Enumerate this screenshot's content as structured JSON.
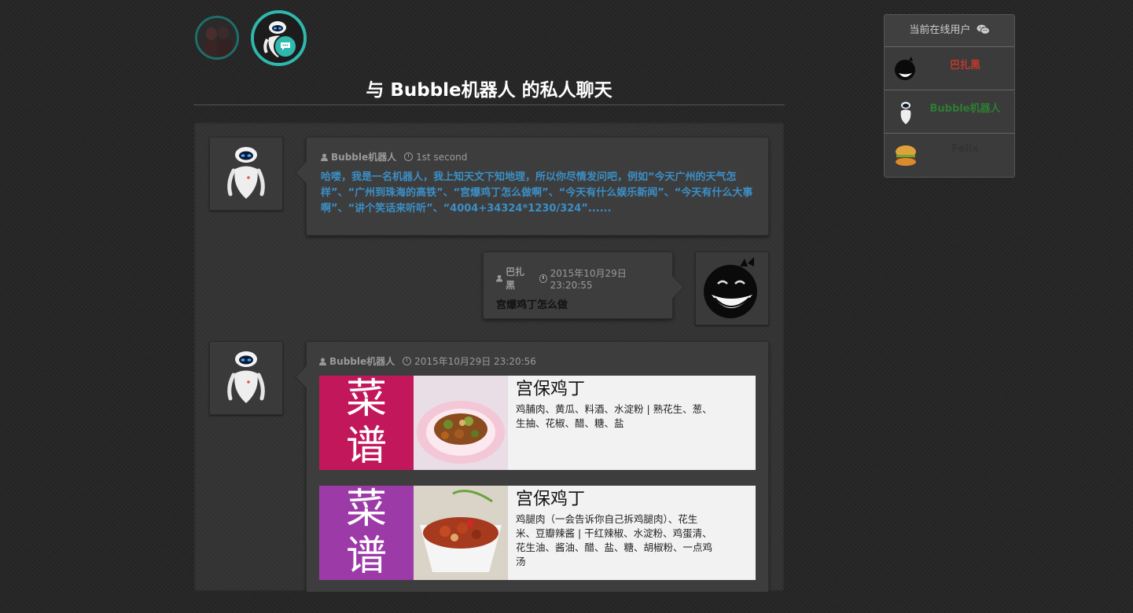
{
  "header": {
    "chat_title": "与 Bubble机器人 的私人聊天"
  },
  "online_users": {
    "title": "当前在线用户",
    "users": [
      {
        "name": "巴扎黑",
        "color": "#c0392b"
      },
      {
        "name": "Bubble机器人",
        "color": "#2e7d32"
      },
      {
        "name": "Felix",
        "color": "#333333"
      }
    ]
  },
  "messages": [
    {
      "sender": "Bubble机器人",
      "time": "1st second",
      "text": "哈喽，我是一名机器人，我上知天文下知地理，所以你尽情发问吧，例如“今天广州的天气怎样”、“广州到珠海的高铁”、“宫爆鸡丁怎么做啊”、“今天有什么娱乐新闻”、“今天有什么大事啊”、“讲个笑话来听听”、“4004+34324*1230/324”......",
      "text_color": "#3b8fc6"
    },
    {
      "sender": "巴扎黑",
      "time": "2015年10月29日 23:20:55",
      "text": "宫爆鸡丁怎么做",
      "text_color": "#111111"
    },
    {
      "sender": "Bubble机器人",
      "time": "2015年10月29日 23:20:56",
      "recipes": [
        {
          "tag_line1": "菜",
          "tag_line2": "谱",
          "tag_color": "#c2185b",
          "title": "宫保鸡丁",
          "desc": "鸡脯肉、黄瓜、料酒、水淀粉 | 熟花生、葱、生抽、花椒、醋、糖、盐"
        },
        {
          "tag_line1": "菜",
          "tag_line2": "谱",
          "tag_color": "#9c3aa8",
          "title": "宫保鸡丁",
          "desc": "鸡腿肉（一会告诉你自己拆鸡腿肉）、花生米、豆瓣辣酱 | 干红辣椒、水淀粉、鸡蛋清、花生油、酱油、醋、盐、糖、胡椒粉、一点鸡汤"
        }
      ]
    }
  ],
  "icons": {
    "user": "user-icon",
    "clock": "clock-icon",
    "wechat": "wechat-icon",
    "chat_badge": "chat-bubble-icon"
  }
}
